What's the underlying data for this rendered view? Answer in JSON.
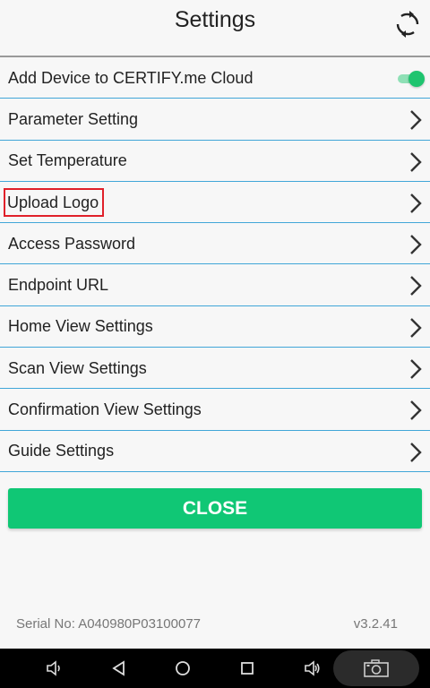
{
  "header": {
    "title": "Settings",
    "refresh_icon": "refresh-icon"
  },
  "settings": [
    {
      "label": "Add Device to CERTIFY.me Cloud",
      "control": "toggle",
      "enabled": true
    },
    {
      "label": "Parameter Setting",
      "control": "chevron"
    },
    {
      "label": "Set Temperature",
      "control": "chevron"
    },
    {
      "label": "Upload Logo",
      "control": "chevron",
      "highlighted": true
    },
    {
      "label": "Access Password",
      "control": "chevron"
    },
    {
      "label": "Endpoint URL",
      "control": "chevron"
    },
    {
      "label": "Home View Settings",
      "control": "chevron"
    },
    {
      "label": "Scan View Settings",
      "control": "chevron"
    },
    {
      "label": "Confirmation View Settings",
      "control": "chevron"
    },
    {
      "label": "Guide Settings",
      "control": "chevron"
    }
  ],
  "close_button": {
    "label": "CLOSE"
  },
  "footer": {
    "serial": "Serial No: A040980P03100077",
    "version": "v3.2.41"
  },
  "colors": {
    "accent_green": "#10c775",
    "divider_blue": "#41a6d8",
    "highlight_red": "#e0202a"
  },
  "navbar": {
    "icons": [
      "volume-down-icon",
      "back-icon",
      "home-icon",
      "recents-icon",
      "volume-up-icon",
      "screenshot-camera-icon"
    ]
  }
}
